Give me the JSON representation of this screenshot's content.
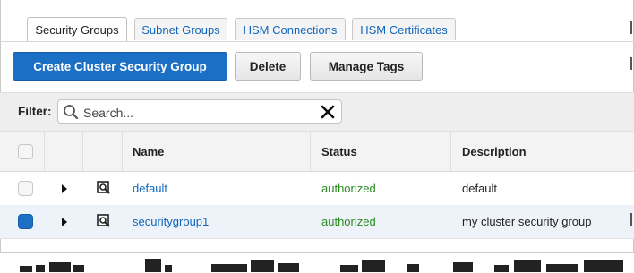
{
  "tabs": [
    {
      "label": "Security Groups",
      "active": true
    },
    {
      "label": "Subnet Groups",
      "active": false
    },
    {
      "label": "HSM Connections",
      "active": false
    },
    {
      "label": "HSM Certificates",
      "active": false
    }
  ],
  "toolbar": {
    "create_label": "Create Cluster Security Group",
    "delete_label": "Delete",
    "manage_tags_label": "Manage Tags"
  },
  "filter": {
    "label": "Filter:",
    "placeholder": "Search...",
    "value": ""
  },
  "table": {
    "columns": [
      "Name",
      "Status",
      "Description"
    ],
    "rows": [
      {
        "name": "default",
        "status": "authorized",
        "description": "default",
        "selected": false
      },
      {
        "name": "securitygroup1",
        "status": "authorized",
        "description": "my cluster security group",
        "selected": true
      }
    ]
  },
  "colors": {
    "accent": "#1b6fc4",
    "link": "#1166bb",
    "status_ok": "#2a8a1f",
    "selected_row": "#eef3fa"
  },
  "icons": {
    "search": "magnifier-icon",
    "clear": "close-x-icon",
    "expand": "caret-right-icon",
    "details": "zoom-details-icon"
  }
}
